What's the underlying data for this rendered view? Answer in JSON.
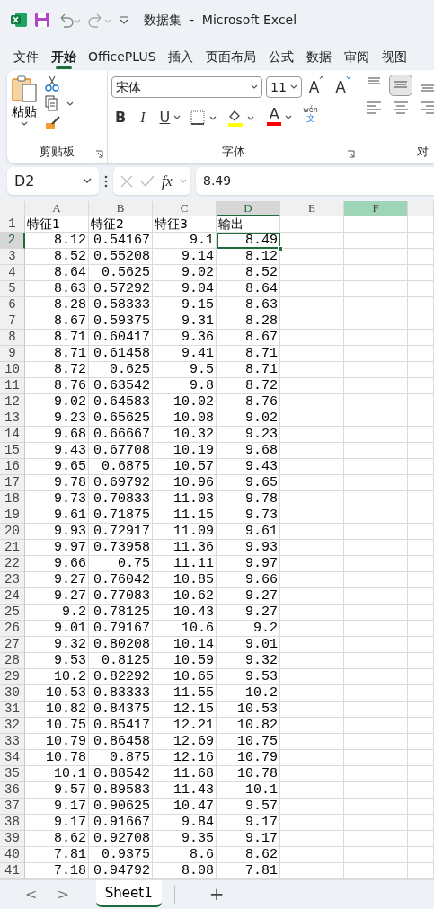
{
  "title_bar": {
    "title": "数据集  -  Microsoft Excel"
  },
  "ribbon_tabs": [
    {
      "label": "文件",
      "selected": false
    },
    {
      "label": "开始",
      "selected": true
    },
    {
      "label": "OfficePLUS",
      "selected": false
    },
    {
      "label": "插入",
      "selected": false
    },
    {
      "label": "页面布局",
      "selected": false
    },
    {
      "label": "公式",
      "selected": false
    },
    {
      "label": "数据",
      "selected": false
    },
    {
      "label": "审阅",
      "selected": false
    },
    {
      "label": "视图",
      "selected": false
    }
  ],
  "ribbon": {
    "clipboard": {
      "paste_label": "粘贴",
      "group_label": "剪贴板"
    },
    "font": {
      "font_name": "宋体",
      "font_size": "11",
      "grow_label": "A",
      "shrink_label": "A",
      "bold_label": "B",
      "italic_label": "I",
      "underline_label": "U",
      "font_color_label": "A",
      "phonetic_top": "wén",
      "phonetic_bottom": "文",
      "group_label": "字体"
    },
    "alignment": {
      "buttons": [
        {
          "kind": "top",
          "selected": false
        },
        {
          "kind": "middle",
          "selected": true
        },
        {
          "kind": "bottom",
          "selected": false
        },
        {
          "kind": "left",
          "selected": false
        },
        {
          "kind": "center",
          "selected": false
        },
        {
          "kind": "right",
          "selected": false
        }
      ],
      "group_label": "对"
    }
  },
  "formula_bar": {
    "name_box": "D2",
    "fx_label": "fx",
    "formula": "8.49"
  },
  "sheet": {
    "columns": [
      {
        "label": "A",
        "selected": false,
        "highlighted": false
      },
      {
        "label": "B",
        "selected": false,
        "highlighted": false
      },
      {
        "label": "C",
        "selected": false,
        "highlighted": false
      },
      {
        "label": "D",
        "selected": true,
        "highlighted": false
      },
      {
        "label": "E",
        "selected": false,
        "highlighted": false
      },
      {
        "label": "F",
        "selected": false,
        "highlighted": true
      }
    ],
    "rows": [
      {
        "number": "1",
        "kind": "header",
        "selected": false,
        "cells": [
          "特征1",
          "特征2",
          "特征3",
          "输出"
        ]
      },
      {
        "number": "2",
        "kind": "data",
        "selected": true,
        "cells": [
          "8.12",
          "0.54167",
          "9.1",
          "8.49"
        ]
      },
      {
        "number": "3",
        "kind": "data",
        "selected": false,
        "cells": [
          "8.52",
          "0.55208",
          "9.14",
          "8.12"
        ]
      },
      {
        "number": "4",
        "kind": "data",
        "selected": false,
        "cells": [
          "8.64",
          "0.5625",
          "9.02",
          "8.52"
        ]
      },
      {
        "number": "5",
        "kind": "data",
        "selected": false,
        "cells": [
          "8.63",
          "0.57292",
          "9.04",
          "8.64"
        ]
      },
      {
        "number": "6",
        "kind": "data",
        "selected": false,
        "cells": [
          "8.28",
          "0.58333",
          "9.15",
          "8.63"
        ]
      },
      {
        "number": "7",
        "kind": "data",
        "selected": false,
        "cells": [
          "8.67",
          "0.59375",
          "9.31",
          "8.28"
        ]
      },
      {
        "number": "8",
        "kind": "data",
        "selected": false,
        "cells": [
          "8.71",
          "0.60417",
          "9.36",
          "8.67"
        ]
      },
      {
        "number": "9",
        "kind": "data",
        "selected": false,
        "cells": [
          "8.71",
          "0.61458",
          "9.41",
          "8.71"
        ]
      },
      {
        "number": "10",
        "kind": "data",
        "selected": false,
        "cells": [
          "8.72",
          "0.625",
          "9.5",
          "8.71"
        ]
      },
      {
        "number": "11",
        "kind": "data",
        "selected": false,
        "cells": [
          "8.76",
          "0.63542",
          "9.8",
          "8.72"
        ]
      },
      {
        "number": "12",
        "kind": "data",
        "selected": false,
        "cells": [
          "9.02",
          "0.64583",
          "10.02",
          "8.76"
        ]
      },
      {
        "number": "13",
        "kind": "data",
        "selected": false,
        "cells": [
          "9.23",
          "0.65625",
          "10.08",
          "9.02"
        ]
      },
      {
        "number": "14",
        "kind": "data",
        "selected": false,
        "cells": [
          "9.68",
          "0.66667",
          "10.32",
          "9.23"
        ]
      },
      {
        "number": "15",
        "kind": "data",
        "selected": false,
        "cells": [
          "9.43",
          "0.67708",
          "10.19",
          "9.68"
        ]
      },
      {
        "number": "16",
        "kind": "data",
        "selected": false,
        "cells": [
          "9.65",
          "0.6875",
          "10.57",
          "9.43"
        ]
      },
      {
        "number": "17",
        "kind": "data",
        "selected": false,
        "cells": [
          "9.78",
          "0.69792",
          "10.96",
          "9.65"
        ]
      },
      {
        "number": "18",
        "kind": "data",
        "selected": false,
        "cells": [
          "9.73",
          "0.70833",
          "11.03",
          "9.78"
        ]
      },
      {
        "number": "19",
        "kind": "data",
        "selected": false,
        "cells": [
          "9.61",
          "0.71875",
          "11.15",
          "9.73"
        ]
      },
      {
        "number": "20",
        "kind": "data",
        "selected": false,
        "cells": [
          "9.93",
          "0.72917",
          "11.09",
          "9.61"
        ]
      },
      {
        "number": "21",
        "kind": "data",
        "selected": false,
        "cells": [
          "9.97",
          "0.73958",
          "11.36",
          "9.93"
        ]
      },
      {
        "number": "22",
        "kind": "data",
        "selected": false,
        "cells": [
          "9.66",
          "0.75",
          "11.11",
          "9.97"
        ]
      },
      {
        "number": "23",
        "kind": "data",
        "selected": false,
        "cells": [
          "9.27",
          "0.76042",
          "10.85",
          "9.66"
        ]
      },
      {
        "number": "24",
        "kind": "data",
        "selected": false,
        "cells": [
          "9.27",
          "0.77083",
          "10.62",
          "9.27"
        ]
      },
      {
        "number": "25",
        "kind": "data",
        "selected": false,
        "cells": [
          "9.2",
          "0.78125",
          "10.43",
          "9.27"
        ]
      },
      {
        "number": "26",
        "kind": "data",
        "selected": false,
        "cells": [
          "9.01",
          "0.79167",
          "10.6",
          "9.2"
        ]
      },
      {
        "number": "27",
        "kind": "data",
        "selected": false,
        "cells": [
          "9.32",
          "0.80208",
          "10.14",
          "9.01"
        ]
      },
      {
        "number": "28",
        "kind": "data",
        "selected": false,
        "cells": [
          "9.53",
          "0.8125",
          "10.59",
          "9.32"
        ]
      },
      {
        "number": "29",
        "kind": "data",
        "selected": false,
        "cells": [
          "10.2",
          "0.82292",
          "10.65",
          "9.53"
        ]
      },
      {
        "number": "30",
        "kind": "data",
        "selected": false,
        "cells": [
          "10.53",
          "0.83333",
          "11.55",
          "10.2"
        ]
      },
      {
        "number": "31",
        "kind": "data",
        "selected": false,
        "cells": [
          "10.82",
          "0.84375",
          "12.15",
          "10.53"
        ]
      },
      {
        "number": "32",
        "kind": "data",
        "selected": false,
        "cells": [
          "10.75",
          "0.85417",
          "12.21",
          "10.82"
        ]
      },
      {
        "number": "33",
        "kind": "data",
        "selected": false,
        "cells": [
          "10.79",
          "0.86458",
          "12.69",
          "10.75"
        ]
      },
      {
        "number": "34",
        "kind": "data",
        "selected": false,
        "cells": [
          "10.78",
          "0.875",
          "12.16",
          "10.79"
        ]
      },
      {
        "number": "35",
        "kind": "data",
        "selected": false,
        "cells": [
          "10.1",
          "0.88542",
          "11.68",
          "10.78"
        ]
      },
      {
        "number": "36",
        "kind": "data",
        "selected": false,
        "cells": [
          "9.57",
          "0.89583",
          "11.43",
          "10.1"
        ]
      },
      {
        "number": "37",
        "kind": "data",
        "selected": false,
        "cells": [
          "9.17",
          "0.90625",
          "10.47",
          "9.57"
        ]
      },
      {
        "number": "38",
        "kind": "data",
        "selected": false,
        "cells": [
          "9.17",
          "0.91667",
          "9.84",
          "9.17"
        ]
      },
      {
        "number": "39",
        "kind": "data",
        "selected": false,
        "cells": [
          "8.62",
          "0.92708",
          "9.35",
          "9.17"
        ]
      },
      {
        "number": "40",
        "kind": "data",
        "selected": false,
        "cells": [
          "7.81",
          "0.9375",
          "8.6",
          "8.62"
        ]
      },
      {
        "number": "41",
        "kind": "data",
        "selected": false,
        "cells": [
          "7.18",
          "0.94792",
          "8.08",
          "7.81"
        ]
      }
    ]
  },
  "sheet_tabs": {
    "prev_label": "<",
    "next_label": ">",
    "tabs": [
      {
        "label": "Sheet1",
        "selected": true
      }
    ],
    "add_label": "+"
  }
}
